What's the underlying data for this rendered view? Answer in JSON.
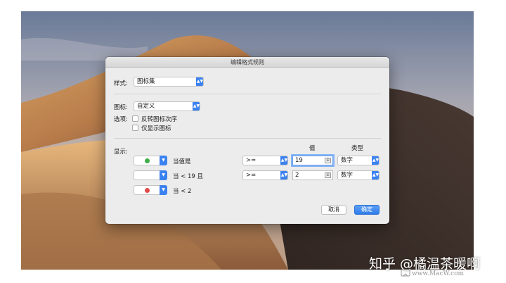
{
  "dialog": {
    "title": "编辑格式规则",
    "style_label": "样式:",
    "style_value": "图标集",
    "icon_label": "图标:",
    "icon_value": "自定义",
    "options_label": "选项:",
    "reverse_label": "反转图标次序",
    "show_icon_only_label": "仅显示图标",
    "display_label": "显示:",
    "col_value": "值",
    "col_type": "类型",
    "rules": [
      {
        "icon": "green-circle",
        "icon_color": "#3fae49",
        "condition": "当值是",
        "operator": ">=",
        "value": "19",
        "type": "数字"
      },
      {
        "icon": "none",
        "icon_color": "",
        "condition": "当 < 19 且",
        "operator": ">=",
        "value": "2",
        "type": "数字"
      },
      {
        "icon": "red-circle",
        "icon_color": "#e14b4b",
        "condition": "当 < 2",
        "operator": "",
        "value": "",
        "type": ""
      }
    ],
    "cancel_label": "取消",
    "ok_label": "确定"
  },
  "watermark": {
    "text": "知乎 @橘温茶暖啊",
    "site": "www.MacW.com"
  },
  "colors": {
    "accent": "#3b82f0",
    "dialog_bg": "#ececec"
  }
}
